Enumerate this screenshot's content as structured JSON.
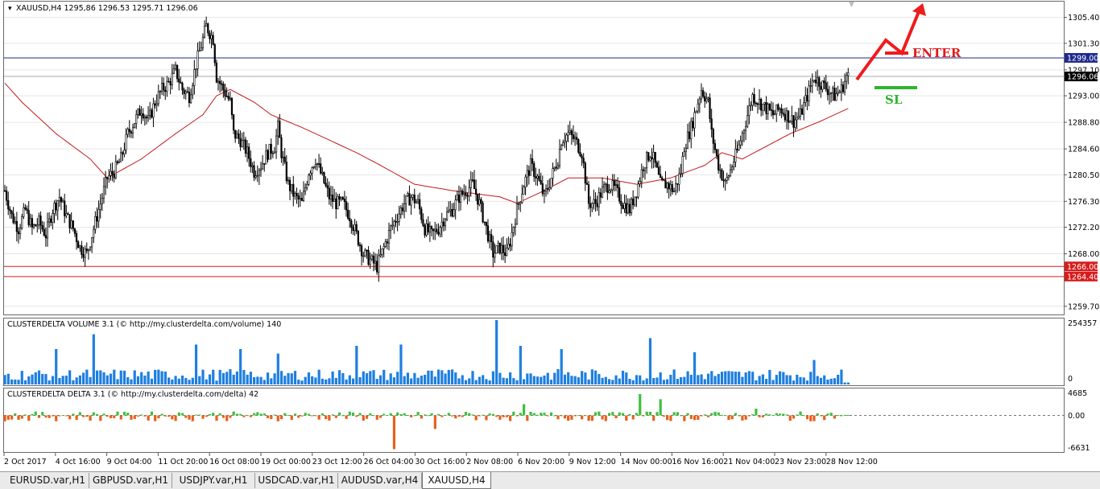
{
  "main": {
    "header": "XAUUSD,H4  1295,86 1296.53 1295.71 1296.06",
    "price_labels": [
      "1305.40",
      "1301.30",
      "1297.10",
      "1293.00",
      "1288.80",
      "1284.60",
      "1280.50",
      "1276.30",
      "1272.20",
      "1268.00",
      "1259.70"
    ],
    "price_tags": [
      {
        "text": "1299.00",
        "color": "#1d2a8c",
        "price": 1299.0
      },
      {
        "text": "1296.06",
        "color": "#000000",
        "price": 1296.06
      },
      {
        "text": "1266.00",
        "color": "#d91c1c",
        "price": 1266.0
      },
      {
        "text": "1264.40",
        "color": "#d91c1c",
        "price": 1264.4
      }
    ],
    "hlines": [
      {
        "price": 1299.0,
        "color": "#1d2a8c"
      },
      {
        "price": 1296.06,
        "color": "#a8a8a8"
      },
      {
        "price": 1266.0,
        "color": "#d91c1c"
      },
      {
        "price": 1264.4,
        "color": "#d91c1c"
      }
    ],
    "annotations": {
      "enter": "ENTER",
      "sl": "SL"
    }
  },
  "volume_panel": {
    "title": "CLUSTERDELTA VOLUME 3.1 (© http://my.clusterdelta.com/volume) 140",
    "max_label": "254357",
    "zero_label": "0",
    "bar_color": "#1e7fe0"
  },
  "delta_panel": {
    "title": "CLUSTERDELTA DELTA 3.1 (© http://my.clusterdelta.com/delta) 42",
    "max_label": "4685",
    "zero_label": "0.00",
    "min_label": "-6631",
    "pos_color": "#3fbf3f",
    "neg_color": "#e8601c"
  },
  "time_labels": [
    "2 Oct 2017",
    "4 Oct 16:00",
    "9 Oct 04:00",
    "11 Oct 20:00",
    "16 Oct 08:00",
    "19 Oct 00:00",
    "23 Oct 12:00",
    "26 Oct 04:00",
    "30 Oct 16:00",
    "2 Nov 08:00",
    "6 Nov 20:00",
    "9 Nov 12:00",
    "14 Nov 00:00",
    "16 Nov 16:00",
    "21 Nov 04:00",
    "23 Nov 23:00",
    "28 Nov 12:00"
  ],
  "tabs": [
    {
      "label": "EURUSD.var,H1",
      "active": false
    },
    {
      "label": "GBPUSD.var,H1",
      "active": false
    },
    {
      "label": "USDJPY.var,H1",
      "active": false
    },
    {
      "label": "USDCAD.var,H1",
      "active": false
    },
    {
      "label": "AUDUSD.var,H4",
      "active": false
    },
    {
      "label": "XAUUSD,H4",
      "active": true
    }
  ],
  "chart_data": {
    "type": "candlestick",
    "symbol": "XAUUSD",
    "timeframe": "H4",
    "ylim": [
      1258.4,
      1307.9
    ],
    "close_path": [
      [
        0,
        1278
      ],
      [
        4,
        1274
      ],
      [
        8,
        1272
      ],
      [
        12,
        1275
      ],
      [
        16,
        1272
      ],
      [
        20,
        1273
      ],
      [
        24,
        1271
      ],
      [
        28,
        1275
      ],
      [
        32,
        1277
      ],
      [
        36,
        1274
      ],
      [
        40,
        1272
      ],
      [
        44,
        1269
      ],
      [
        48,
        1268
      ],
      [
        52,
        1272
      ],
      [
        56,
        1276
      ],
      [
        60,
        1280
      ],
      [
        64,
        1281
      ],
      [
        68,
        1283
      ],
      [
        72,
        1287
      ],
      [
        76,
        1289
      ],
      [
        80,
        1291
      ],
      [
        84,
        1289
      ],
      [
        88,
        1292
      ],
      [
        92,
        1294
      ],
      [
        96,
        1295
      ],
      [
        100,
        1297
      ],
      [
        104,
        1294
      ],
      [
        108,
        1293
      ],
      [
        112,
        1298
      ],
      [
        116,
        1302
      ],
      [
        118,
        1304
      ],
      [
        120,
        1303
      ],
      [
        122,
        1302
      ],
      [
        124,
        1296
      ],
      [
        128,
        1294
      ],
      [
        132,
        1292
      ],
      [
        134,
        1287
      ],
      [
        138,
        1286
      ],
      [
        142,
        1284
      ],
      [
        146,
        1281
      ],
      [
        150,
        1282
      ],
      [
        154,
        1284
      ],
      [
        158,
        1285
      ],
      [
        160,
        1288
      ],
      [
        162,
        1284
      ],
      [
        166,
        1279
      ],
      [
        170,
        1277
      ],
      [
        174,
        1276
      ],
      [
        178,
        1281
      ],
      [
        182,
        1283
      ],
      [
        186,
        1280
      ],
      [
        190,
        1277
      ],
      [
        194,
        1276
      ],
      [
        198,
        1276
      ],
      [
        202,
        1274
      ],
      [
        206,
        1271
      ],
      [
        210,
        1268
      ],
      [
        214,
        1267
      ],
      [
        218,
        1266
      ],
      [
        222,
        1269
      ],
      [
        226,
        1272
      ],
      [
        230,
        1274
      ],
      [
        234,
        1276
      ],
      [
        238,
        1277
      ],
      [
        242,
        1276
      ],
      [
        246,
        1272
      ],
      [
        250,
        1271
      ],
      [
        254,
        1272
      ],
      [
        258,
        1274
      ],
      [
        262,
        1275
      ],
      [
        266,
        1277
      ],
      [
        270,
        1278
      ],
      [
        274,
        1279
      ],
      [
        278,
        1276
      ],
      [
        282,
        1272
      ],
      [
        286,
        1268
      ],
      [
        290,
        1269
      ],
      [
        294,
        1268
      ],
      [
        296,
        1270
      ],
      [
        300,
        1275
      ],
      [
        304,
        1279
      ],
      [
        308,
        1282
      ],
      [
        312,
        1280
      ],
      [
        316,
        1277
      ],
      [
        320,
        1280
      ],
      [
        324,
        1283
      ],
      [
        326,
        1286
      ],
      [
        330,
        1287
      ],
      [
        334,
        1286
      ],
      [
        338,
        1284
      ],
      [
        342,
        1276
      ],
      [
        346,
        1276
      ],
      [
        350,
        1278
      ],
      [
        354,
        1279
      ],
      [
        358,
        1278
      ],
      [
        362,
        1276
      ],
      [
        366,
        1275
      ],
      [
        370,
        1278
      ],
      [
        374,
        1282
      ],
      [
        378,
        1284
      ],
      [
        380,
        1283
      ],
      [
        384,
        1279
      ],
      [
        388,
        1279
      ],
      [
        392,
        1278
      ],
      [
        396,
        1281
      ],
      [
        398,
        1285
      ],
      [
        402,
        1288
      ],
      [
        406,
        1292
      ],
      [
        408,
        1294
      ],
      [
        412,
        1292
      ],
      [
        414,
        1287
      ],
      [
        418,
        1282
      ],
      [
        422,
        1279
      ],
      [
        426,
        1282
      ],
      [
        430,
        1285
      ],
      [
        434,
        1289
      ],
      [
        438,
        1293
      ],
      [
        442,
        1292
      ],
      [
        446,
        1291
      ],
      [
        450,
        1290
      ],
      [
        454,
        1291
      ],
      [
        458,
        1290
      ],
      [
        462,
        1289
      ],
      [
        466,
        1290
      ],
      [
        470,
        1293
      ],
      [
        474,
        1296
      ],
      [
        478,
        1295
      ],
      [
        482,
        1294
      ],
      [
        486,
        1293
      ],
      [
        490,
        1294
      ],
      [
        493,
        1296
      ]
    ],
    "ma_path": [
      [
        0,
        1295
      ],
      [
        10,
        1292
      ],
      [
        30,
        1287
      ],
      [
        50,
        1283
      ],
      [
        60,
        1280
      ],
      [
        80,
        1283
      ],
      [
        100,
        1287
      ],
      [
        116,
        1290
      ],
      [
        124,
        1293
      ],
      [
        132,
        1294
      ],
      [
        146,
        1292
      ],
      [
        156,
        1290
      ],
      [
        174,
        1288
      ],
      [
        190,
        1286
      ],
      [
        206,
        1284
      ],
      [
        220,
        1282
      ],
      [
        240,
        1279
      ],
      [
        262,
        1278
      ],
      [
        290,
        1277
      ],
      [
        300,
        1276
      ],
      [
        316,
        1278
      ],
      [
        330,
        1280
      ],
      [
        350,
        1280
      ],
      [
        370,
        1279
      ],
      [
        390,
        1280
      ],
      [
        410,
        1282
      ],
      [
        420,
        1284
      ],
      [
        432,
        1283
      ],
      [
        446,
        1285
      ],
      [
        460,
        1287
      ],
      [
        478,
        1289
      ],
      [
        494,
        1291
      ]
    ],
    "levels": [
      1299.0,
      1296.06,
      1266.0,
      1264.4
    ],
    "volume_peaks": [
      [
        30,
        0.55
      ],
      [
        52,
        0.78
      ],
      [
        112,
        0.62
      ],
      [
        138,
        0.55
      ],
      [
        160,
        0.48
      ],
      [
        206,
        0.6
      ],
      [
        232,
        0.62
      ],
      [
        288,
        1.0
      ],
      [
        302,
        0.6
      ],
      [
        326,
        0.55
      ],
      [
        378,
        0.72
      ],
      [
        404,
        0.5
      ],
      [
        474,
        0.38
      ]
    ],
    "delta_peaks": [
      [
        228,
        -1.0
      ],
      [
        372,
        0.95
      ],
      [
        384,
        0.72
      ],
      [
        304,
        0.5
      ],
      [
        252,
        -0.4
      ],
      [
        440,
        0.3
      ]
    ]
  }
}
